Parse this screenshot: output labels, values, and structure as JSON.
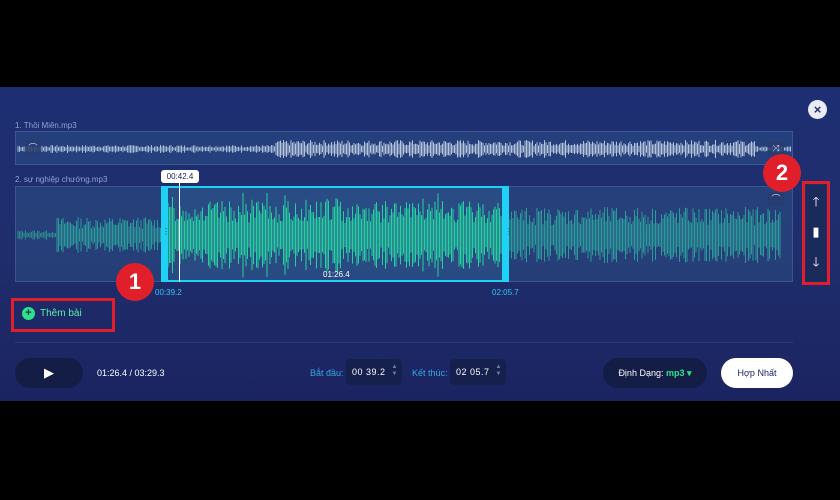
{
  "tracks": [
    {
      "label": "1. Thôi Miên.mp3"
    },
    {
      "label": "2. sự nghiệp chướng.mp3"
    }
  ],
  "selection": {
    "playhead_time": "00:42.4",
    "duration_label": "01:26.4",
    "start_time_label": "00:39.2",
    "end_time_label": "02:05.7"
  },
  "add_song": {
    "label": "Thêm bài"
  },
  "annotations": {
    "badge1": "1",
    "badge2": "2"
  },
  "player": {
    "time": "01:26.4 / 03:29.3"
  },
  "start_field": {
    "label": "Bắt đầu:",
    "value": "00 39.2"
  },
  "end_field": {
    "label": "Kết thúc:",
    "value": "02 05.7"
  },
  "format": {
    "label": "Định Dạng:",
    "value": "mp3"
  },
  "merge": {
    "label": "Hợp Nhất"
  },
  "colors": {
    "accent_cyan": "#1fd2f5",
    "accent_green": "#2ee08a",
    "annotation_red": "#e01f2b",
    "panel_bg": "#1f2d6c"
  },
  "icons": {
    "close": "close-icon",
    "play": "play-icon",
    "up": "arrow-up-icon",
    "delete": "trash-icon",
    "down": "arrow-down-icon",
    "add": "plus-circle-icon"
  }
}
